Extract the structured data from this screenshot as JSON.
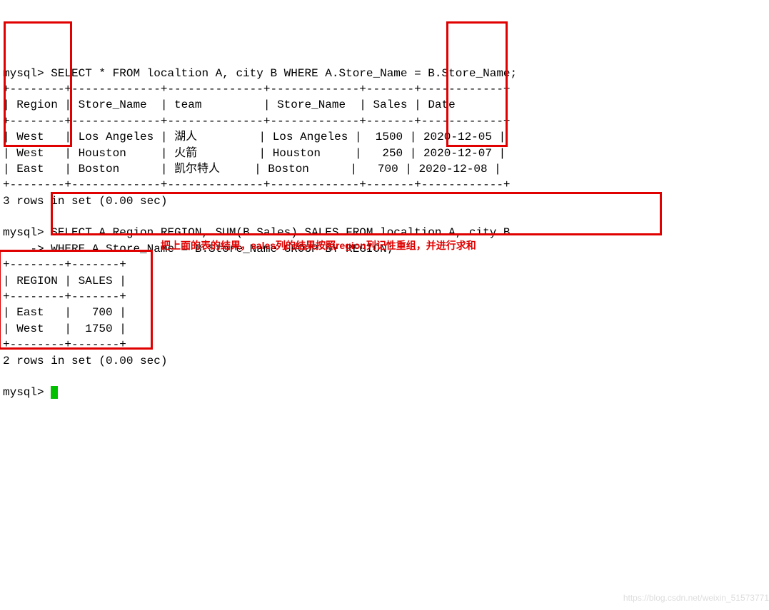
{
  "query1": {
    "prompt": "mysql>",
    "sql": "SELECT * FROM localtion A, city B WHERE A.Store_Name = B.Store_Name;",
    "headers": [
      "Region",
      "Store_Name",
      "team",
      "Store_Name",
      "Sales",
      "Date"
    ],
    "rows": [
      {
        "Region": "West",
        "Store_Name_A": "Los Angeles",
        "team": "湖人",
        "Store_Name_B": "Los Angeles",
        "Sales": "1500",
        "Date": "2020-12-05"
      },
      {
        "Region": "West",
        "Store_Name_A": "Houston",
        "team": "火箭",
        "Store_Name_B": "Houston",
        "Sales": " 250",
        "Date": "2020-12-07"
      },
      {
        "Region": "East",
        "Store_Name_A": "Boston",
        "team": "凯尔特人",
        "Store_Name_B": "Boston",
        "Sales": " 700",
        "Date": "2020-12-08"
      }
    ],
    "footer": "3 rows in set (0.00 sec)"
  },
  "query2": {
    "prompt": "mysql>",
    "cont": "    ->",
    "sql_line1": "SELECT A.Region REGION, SUM(B.Sales) SALES FROM localtion A, city B",
    "sql_line2": "WHERE A.Store_Name = B.Store_Name GROUP BY REGION;",
    "headers": [
      "REGION",
      "SALES"
    ],
    "rows": [
      {
        "REGION": "East",
        "SALES": "  700"
      },
      {
        "REGION": "West",
        "SALES": " 1750"
      }
    ],
    "footer": "2 rows in set (0.00 sec)"
  },
  "annotation": "把上面的表的结果，sales列的结果按照region列记性重组，并进行求和",
  "final_prompt": "mysql>",
  "watermark": "https://blog.csdn.net/weixin_51573771"
}
